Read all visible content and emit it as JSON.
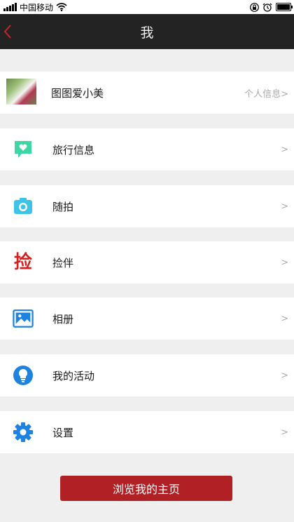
{
  "status": {
    "carrier": "中国移动",
    "icons": [
      "signal-icon",
      "wifi-icon",
      "lock-icon",
      "alarm-icon",
      "battery-icon"
    ]
  },
  "nav": {
    "title": "我",
    "back_icon": "chevron-left-icon"
  },
  "profile": {
    "name": "图图爱小美",
    "hint": "个人信息>"
  },
  "menu": [
    {
      "label": "旅行信息",
      "icon": "heart-chat-icon",
      "arrow": ">"
    },
    {
      "label": "随拍",
      "icon": "camera-icon",
      "arrow": ">"
    },
    {
      "label": "捡伴",
      "icon": "pick-glyph-icon",
      "glyph": "捡",
      "arrow": ">"
    },
    {
      "label": "相册",
      "icon": "album-icon",
      "arrow": ">"
    },
    {
      "label": "我的活动",
      "icon": "lightbulb-icon",
      "arrow": ">"
    },
    {
      "label": "设置",
      "icon": "gear-icon",
      "arrow": ">"
    }
  ],
  "button": {
    "label": "浏览我的主页"
  },
  "colors": {
    "accent": "#b02024",
    "nav_bg": "#232323",
    "page_bg": "#efefef",
    "travel_icon": "#3dd6a5",
    "camera_icon": "#3ec3e8",
    "pick_icon": "#d91e1e",
    "blue_icon": "#1e82e0"
  }
}
